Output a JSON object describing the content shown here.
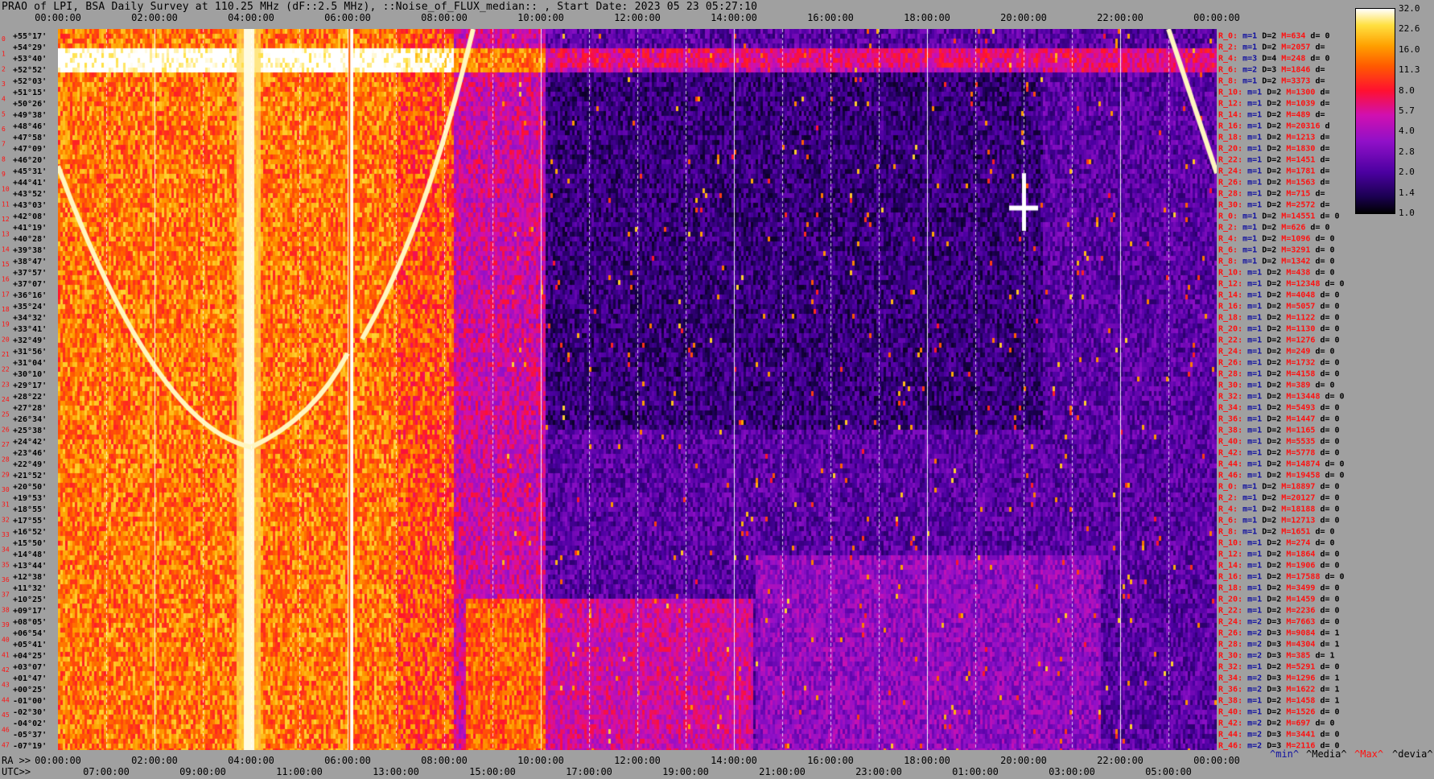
{
  "title": "PRAO of LPI, BSA Daily Survey at 110.25 MHz (dF::2.5 MHz), ::Noise_of_FLUX_median:: , Start Date: 2023 05 23 05:27:10",
  "axes": {
    "top_ticks": [
      "00:00:00",
      "02:00:00",
      "04:00:00",
      "06:00:00",
      "08:00:00",
      "10:00:00",
      "12:00:00",
      "14:00:00",
      "16:00:00",
      "18:00:00",
      "20:00:00",
      "22:00:00",
      "00:00:00"
    ],
    "ra_prefix": "RA >>",
    "bottom_ra_ticks": [
      "00:00:00",
      "02:00:00",
      "04:00:00",
      "06:00:00",
      "08:00:00",
      "10:00:00",
      "12:00:00",
      "14:00:00",
      "16:00:00",
      "18:00:00",
      "20:00:00",
      "22:00:00",
      "00:00:00"
    ],
    "utc_prefix": "UTC>>",
    "bottom_utc_ticks": [
      "07:00:00",
      "09:00:00",
      "11:00:00",
      "13:00:00",
      "15:00:00",
      "17:00:00",
      "19:00:00",
      "21:00:00",
      "23:00:00",
      "01:00:00",
      "03:00:00",
      "05:00:00"
    ],
    "declinations": [
      "+55°17'",
      "+54°29'",
      "+53°40'",
      "+52°52'",
      "+52°03'",
      "+51°15'",
      "+50°26'",
      "+49°38'",
      "+48°46'",
      "+47°58'",
      "+47°09'",
      "+46°20'",
      "+45°31'",
      "+44°41'",
      "+43°52'",
      "+43°03'",
      "+42°08'",
      "+41°19'",
      "+40°28'",
      "+39°38'",
      "+38°47'",
      "+37°57'",
      "+37°07'",
      "+36°16'",
      "+35°24'",
      "+34°32'",
      "+33°41'",
      "+32°49'",
      "+31°56'",
      "+31°04'",
      "+30°10'",
      "+29°17'",
      "+28°22'",
      "+27°28'",
      "+26°34'",
      "+25°38'",
      "+24°42'",
      "+23°46'",
      "+22°49'",
      "+21°52'",
      "+20°50'",
      "+19°53'",
      "+18°55'",
      "+17°55'",
      "+16°52'",
      "+15°50'",
      "+14°48'",
      "+13°44'",
      "+12°38'",
      "+11°32'",
      "+10°25'",
      "+09°17'",
      "+08°05'",
      "+06°54'",
      "+05°41'",
      "+04°25'",
      "+03°07'",
      "+01°47'",
      "+00°25'",
      "-01°00'",
      "-02°30'",
      "-04°02'",
      "-05°37'",
      "-07°19'"
    ],
    "row_numbers": [
      "0",
      "1",
      "2",
      "3",
      "4",
      "5",
      "6",
      "7",
      "8",
      "9",
      "10",
      "11",
      "12",
      "13",
      "14",
      "15",
      "16",
      "17",
      "18",
      "19",
      "20",
      "21",
      "22",
      "23",
      "24",
      "25",
      "26",
      "27",
      "28",
      "29",
      "30",
      "31",
      "32",
      "33",
      "34",
      "35",
      "36",
      "37",
      "38",
      "39",
      "40",
      "41",
      "42",
      "43",
      "44",
      "45",
      "46",
      "47"
    ]
  },
  "colorbar": {
    "ticks": [
      "32.0",
      "22.6",
      "16.0",
      "11.3",
      "8.0",
      "5.7",
      "4.0",
      "2.8",
      "2.0",
      "1.4",
      "1.0"
    ]
  },
  "stats_rows": [
    {
      "r": "R_0:",
      "m": "m=1",
      "d": "D=2",
      "M": "M=634",
      "dd": "d= 0"
    },
    {
      "r": "R_2:",
      "m": "m=1",
      "d": "D=2",
      "M": "M=2057",
      "dd": "d="
    },
    {
      "r": "R_4:",
      "m": "m=3",
      "d": "D=4",
      "M": "M=248",
      "dd": "d= 0"
    },
    {
      "r": "R_6:",
      "m": "m=2",
      "d": "D=3",
      "M": "M=1846",
      "dd": "d="
    },
    {
      "r": "R_8:",
      "m": "m=1",
      "d": "D=2",
      "M": "M=3373",
      "dd": "d="
    },
    {
      "r": "R_10:",
      "m": "m=1",
      "d": "D=2",
      "M": "M=1300",
      "dd": "d="
    },
    {
      "r": "R_12:",
      "m": "m=1",
      "d": "D=2",
      "M": "M=1039",
      "dd": "d="
    },
    {
      "r": "R_14:",
      "m": "m=1",
      "d": "D=2",
      "M": "M=489",
      "dd": "d="
    },
    {
      "r": "R_16:",
      "m": "m=1",
      "d": "D=2",
      "M": "M=20316",
      "dd": "d"
    },
    {
      "r": "R_18:",
      "m": "m=1",
      "d": "D=2",
      "M": "M=1213",
      "dd": "d="
    },
    {
      "r": "R_20:",
      "m": "m=1",
      "d": "D=2",
      "M": "M=1830",
      "dd": "d="
    },
    {
      "r": "R_22:",
      "m": "m=1",
      "d": "D=2",
      "M": "M=1451",
      "dd": "d="
    },
    {
      "r": "R_24:",
      "m": "m=1",
      "d": "D=2",
      "M": "M=1781",
      "dd": "d="
    },
    {
      "r": "R_26:",
      "m": "m=1",
      "d": "D=2",
      "M": "M=1563",
      "dd": "d="
    },
    {
      "r": "R_28:",
      "m": "m=1",
      "d": "D=2",
      "M": "M=715",
      "dd": "d="
    },
    {
      "r": "R_30:",
      "m": "m=1",
      "d": "D=2",
      "M": "M=2572",
      "dd": "d="
    },
    {
      "r": "R_0:",
      "m": "m=1",
      "d": "D=2",
      "M": "M=14551",
      "dd": "d= 0"
    },
    {
      "r": "R_2:",
      "m": "m=1",
      "d": "D=2",
      "M": "M=626",
      "dd": "d= 0"
    },
    {
      "r": "R_4:",
      "m": "m=1",
      "d": "D=2",
      "M": "M=1096",
      "dd": "d= 0"
    },
    {
      "r": "R_6:",
      "m": "m=1",
      "d": "D=2",
      "M": "M=3291",
      "dd": "d= 0"
    },
    {
      "r": "R_8:",
      "m": "m=1",
      "d": "D=2",
      "M": "M=1342",
      "dd": "d= 0"
    },
    {
      "r": "R_10:",
      "m": "m=1",
      "d": "D=2",
      "M": "M=438",
      "dd": "d= 0"
    },
    {
      "r": "R_12:",
      "m": "m=1",
      "d": "D=2",
      "M": "M=12348",
      "dd": "d= 0"
    },
    {
      "r": "R_14:",
      "m": "m=1",
      "d": "D=2",
      "M": "M=4048",
      "dd": "d= 0"
    },
    {
      "r": "R_16:",
      "m": "m=1",
      "d": "D=2",
      "M": "M=5057",
      "dd": "d= 0"
    },
    {
      "r": "R_18:",
      "m": "m=1",
      "d": "D=2",
      "M": "M=1122",
      "dd": "d= 0"
    },
    {
      "r": "R_20:",
      "m": "m=1",
      "d": "D=2",
      "M": "M=1130",
      "dd": "d= 0"
    },
    {
      "r": "R_22:",
      "m": "m=1",
      "d": "D=2",
      "M": "M=1276",
      "dd": "d= 0"
    },
    {
      "r": "R_24:",
      "m": "m=1",
      "d": "D=2",
      "M": "M=249",
      "dd": "d= 0"
    },
    {
      "r": "R_26:",
      "m": "m=1",
      "d": "D=2",
      "M": "M=1732",
      "dd": "d= 0"
    },
    {
      "r": "R_28:",
      "m": "m=1",
      "d": "D=2",
      "M": "M=4158",
      "dd": "d= 0"
    },
    {
      "r": "R_30:",
      "m": "m=1",
      "d": "D=2",
      "M": "M=389",
      "dd": "d= 0"
    },
    {
      "r": "R_32:",
      "m": "m=1",
      "d": "D=2",
      "M": "M=13448",
      "dd": "d= 0"
    },
    {
      "r": "R_34:",
      "m": "m=1",
      "d": "D=2",
      "M": "M=5493",
      "dd": "d= 0"
    },
    {
      "r": "R_36:",
      "m": "m=1",
      "d": "D=2",
      "M": "M=1447",
      "dd": "d= 0"
    },
    {
      "r": "R_38:",
      "m": "m=1",
      "d": "D=2",
      "M": "M=1165",
      "dd": "d= 0"
    },
    {
      "r": "R_40:",
      "m": "m=1",
      "d": "D=2",
      "M": "M=5535",
      "dd": "d= 0"
    },
    {
      "r": "R_42:",
      "m": "m=1",
      "d": "D=2",
      "M": "M=5778",
      "dd": "d= 0"
    },
    {
      "r": "R_44:",
      "m": "m=1",
      "d": "D=2",
      "M": "M=14874",
      "dd": "d= 0"
    },
    {
      "r": "R_46:",
      "m": "m=1",
      "d": "D=2",
      "M": "M=19458",
      "dd": "d= 0"
    },
    {
      "r": "R_0:",
      "m": "m=1",
      "d": "D=2",
      "M": "M=18897",
      "dd": "d= 0"
    },
    {
      "r": "R_2:",
      "m": "m=1",
      "d": "D=2",
      "M": "M=20127",
      "dd": "d= 0"
    },
    {
      "r": "R_4:",
      "m": "m=1",
      "d": "D=2",
      "M": "M=18188",
      "dd": "d= 0"
    },
    {
      "r": "R_6:",
      "m": "m=1",
      "d": "D=2",
      "M": "M=12713",
      "dd": "d= 0"
    },
    {
      "r": "R_8:",
      "m": "m=1",
      "d": "D=2",
      "M": "M=1651",
      "dd": "d= 0"
    },
    {
      "r": "R_10:",
      "m": "m=1",
      "d": "D=2",
      "M": "M=274",
      "dd": "d= 0"
    },
    {
      "r": "R_12:",
      "m": "m=1",
      "d": "D=2",
      "M": "M=1864",
      "dd": "d= 0"
    },
    {
      "r": "R_14:",
      "m": "m=1",
      "d": "D=2",
      "M": "M=1906",
      "dd": "d= 0"
    },
    {
      "r": "R_16:",
      "m": "m=1",
      "d": "D=2",
      "M": "M=17588",
      "dd": "d= 0"
    },
    {
      "r": "R_18:",
      "m": "m=1",
      "d": "D=2",
      "M": "M=3499",
      "dd": "d= 0"
    },
    {
      "r": "R_20:",
      "m": "m=1",
      "d": "D=2",
      "M": "M=1459",
      "dd": "d= 0"
    },
    {
      "r": "R_22:",
      "m": "m=1",
      "d": "D=2",
      "M": "M=2236",
      "dd": "d= 0"
    },
    {
      "r": "R_24:",
      "m": "m=2",
      "d": "D=3",
      "M": "M=7663",
      "dd": "d= 0"
    },
    {
      "r": "R_26:",
      "m": "m=2",
      "d": "D=3",
      "M": "M=9084",
      "dd": "d= 1"
    },
    {
      "r": "R_28:",
      "m": "m=2",
      "d": "D=3",
      "M": "M=4304",
      "dd": "d= 1"
    },
    {
      "r": "R_30:",
      "m": "m=2",
      "d": "D=3",
      "M": "M=385",
      "dd": "d= 1"
    },
    {
      "r": "R_32:",
      "m": "m=1",
      "d": "D=2",
      "M": "M=5291",
      "dd": "d= 0"
    },
    {
      "r": "R_34:",
      "m": "m=2",
      "d": "D=3",
      "M": "M=1296",
      "dd": "d= 1"
    },
    {
      "r": "R_36:",
      "m": "m=2",
      "d": "D=3",
      "M": "M=1622",
      "dd": "d= 1"
    },
    {
      "r": "R_38:",
      "m": "m=1",
      "d": "D=2",
      "M": "M=1458",
      "dd": "d= 1"
    },
    {
      "r": "R_40:",
      "m": "m=1",
      "d": "D=2",
      "M": "M=1526",
      "dd": "d= 0"
    },
    {
      "r": "R_42:",
      "m": "m=2",
      "d": "D=2",
      "M": "M=697",
      "dd": "d= 0"
    },
    {
      "r": "R_44:",
      "m": "m=2",
      "d": "D=3",
      "M": "M=3441",
      "dd": "d= 0"
    },
    {
      "r": "R_46:",
      "m": "m=2",
      "d": "D=3",
      "M": "M=2116",
      "dd": "d= 0"
    }
  ],
  "footer_legend": {
    "min": "^min^",
    "median": "^Media^",
    "max": "^Max^",
    "devia": "^devia^"
  },
  "colors": {
    "background": "#a0a0a0",
    "label_red": "#ff1010",
    "label_blue": "#1010a0",
    "label_dark": "#000000"
  },
  "chart_data": {
    "type": "heatmap",
    "title": "PRAO of LPI, BSA Daily Survey at 110.25 MHz (dF::2.5 MHz), ::Noise_of_FLUX_median:: , Start Date: 2023 05 23 05:27:10",
    "x_axis": {
      "label": "RA",
      "range": [
        "00:00:00",
        "24:00:00"
      ],
      "tick_step_hours": 2
    },
    "y_axis": {
      "label": "Declination",
      "range": [
        "+55°17'",
        "-07°19'"
      ],
      "rows": 64
    },
    "color_scale": {
      "type": "log",
      "min": 1.0,
      "max": 32.0
    },
    "features": [
      {
        "desc": "bright vertical band",
        "ra_hours": [
          3.7,
          4.3
        ]
      },
      {
        "desc": "white vertical line",
        "ra_hours": [
          6.05,
          6.15
        ]
      },
      {
        "desc": "curved bright arc (left)",
        "ra_hours": [
          0.0,
          6.0
        ]
      },
      {
        "desc": "curved bright arc (right)",
        "ra_hours": [
          6.3,
          8.4
        ]
      },
      {
        "desc": "diagonal bright line (top right)",
        "ra_hours": [
          23.0,
          24.0
        ]
      },
      {
        "desc": "bright point source cross",
        "ra_hours": [
          20.0,
          20.0
        ],
        "dec": "+40°28'"
      }
    ]
  }
}
